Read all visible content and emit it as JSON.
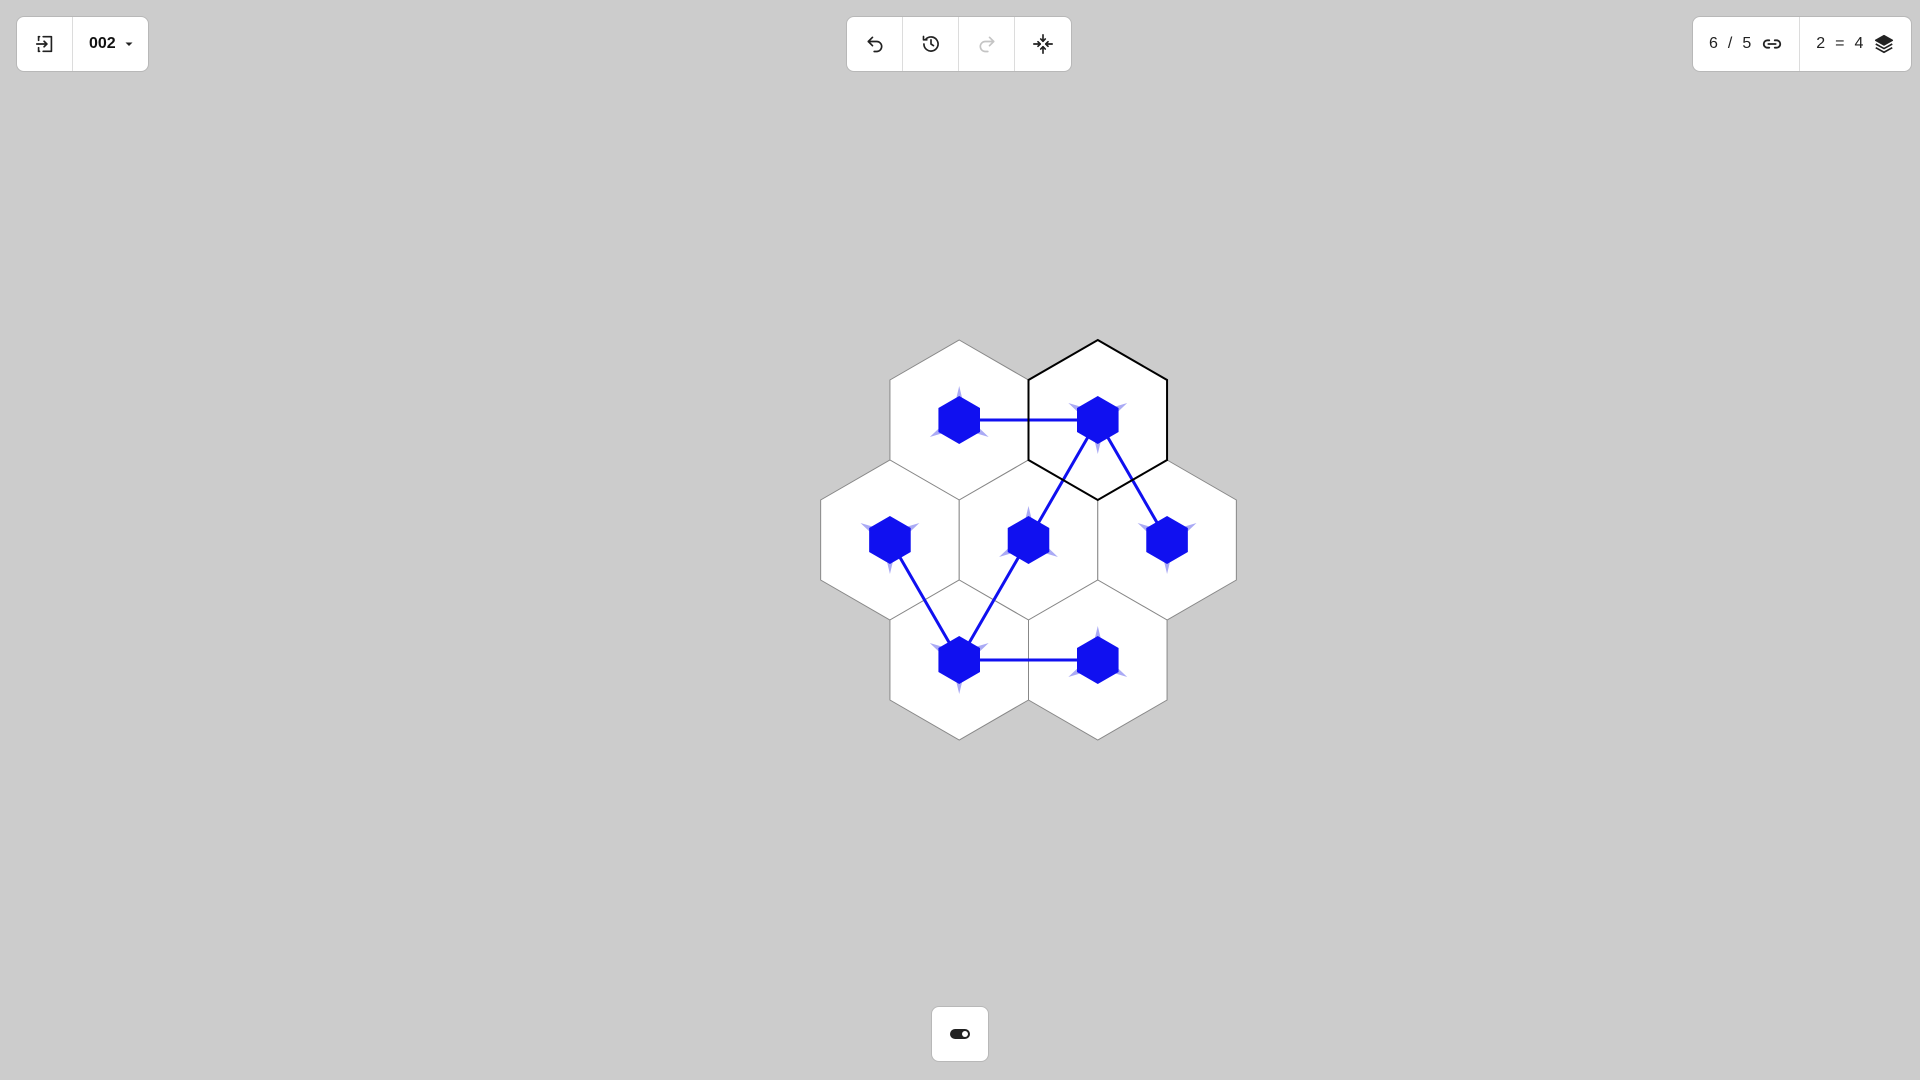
{
  "toolbar_left": {
    "exit_icon": "exit-icon",
    "level": "002",
    "level_dropdown_icon": "caret-down-icon"
  },
  "toolbar_center": {
    "undo_icon": "undo-icon",
    "history_icon": "history-icon",
    "redo_icon": "redo-icon",
    "redo_enabled": false,
    "recenter_icon": "collapse-arrows-icon"
  },
  "toolbar_right": {
    "links_current": "6",
    "links_separator": "/",
    "links_target": "5",
    "links_icon": "link-icon",
    "layers_left": "2",
    "layers_separator": "=",
    "layers_right": "4",
    "layers_icon": "layers-icon"
  },
  "toolbar_bottom": {
    "toggle_icon": "toggle-switch-icon"
  },
  "colors": {
    "background": "#cccccc",
    "tile_fill": "#ffffff",
    "tile_border": "#888888",
    "selected_border": "#000000",
    "path": "#1010f0",
    "ghost": "#aaaaf5"
  },
  "board": {
    "tiles": [
      {
        "q": 0,
        "r": -1,
        "selected": false
      },
      {
        "q": 1,
        "r": -1,
        "selected": true
      },
      {
        "q": -1,
        "r": 0,
        "selected": false
      },
      {
        "q": 0,
        "r": 0,
        "selected": false
      },
      {
        "q": 1,
        "r": 0,
        "selected": false
      },
      {
        "q": -1,
        "r": 1,
        "selected": false
      },
      {
        "q": 0,
        "r": 1,
        "selected": false
      }
    ],
    "path": [
      {
        "q": 0,
        "r": -1
      },
      {
        "q": 1,
        "r": -1
      },
      {
        "q": 0,
        "r": 0
      },
      {
        "q": -1,
        "r": 1
      },
      {
        "q": -1,
        "r": 0
      }
    ],
    "path_branch": [
      {
        "q": 1,
        "r": -1
      },
      {
        "q": 1,
        "r": 0
      }
    ],
    "path_branch2": [
      {
        "q": -1,
        "r": 1
      },
      {
        "q": 0,
        "r": 1
      }
    ]
  }
}
